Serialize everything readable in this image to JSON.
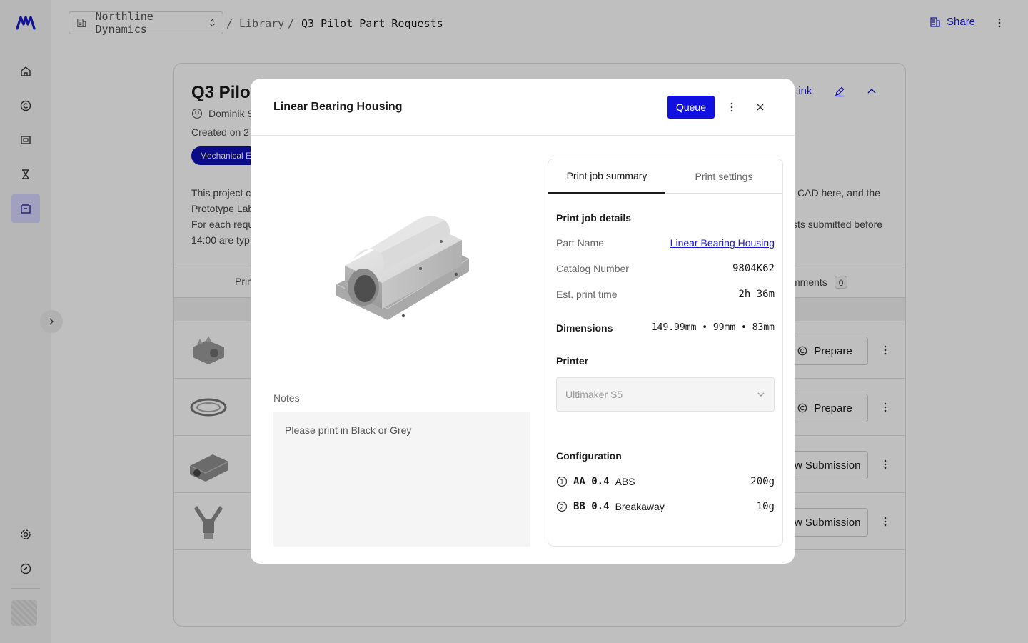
{
  "topbar": {
    "org": "Northline Dynamics",
    "breadcrumbs": [
      "Library",
      "Q3 Pilot Part Requests"
    ],
    "share_label": "Share"
  },
  "project": {
    "title": "Q3 Pilot Part Requests",
    "owner": "Dominik S",
    "created": "Created on 2",
    "tag": "Mechanical E",
    "description_left": [
      "This project c",
      "Prototype Lab",
      "For each requ",
      "14:00 are typ"
    ],
    "description_right": [
      "CAD here, and the",
      "",
      "sts submitted before",
      ""
    ],
    "link_label": "Link",
    "tabs": {
      "first": "Prin",
      "comments": "mments",
      "comments_count": "0"
    },
    "rows": [
      {
        "action": "Prepare"
      },
      {
        "action": "Prepare"
      },
      {
        "action": "ew Submission"
      },
      {
        "action": "ew Submission"
      }
    ]
  },
  "modal": {
    "title": "Linear Bearing Housing",
    "queue_label": "Queue",
    "notes_label": "Notes",
    "notes_value": "Please print in Black or Grey",
    "tabs": [
      "Print job summary",
      "Print settings"
    ],
    "details": {
      "section_title": "Print job details",
      "part_name_label": "Part Name",
      "part_name_value": "Linear Bearing Housing",
      "catalog_label": "Catalog Number",
      "catalog_value": "9804K62",
      "time_label": "Est. print time",
      "time_value": "2h 36m",
      "dimensions_label": "Dimensions",
      "dimensions_value": "149.99mm • 99mm • 83mm"
    },
    "printer": {
      "section_title": "Printer",
      "selected": "Ultimaker S5"
    },
    "configuration": {
      "section_title": "Configuration",
      "extruders": [
        {
          "index": "1",
          "nozzle": "AA 0.4",
          "material": "ABS",
          "weight": "200g"
        },
        {
          "index": "2",
          "nozzle": "BB 0.4",
          "material": "Breakaway",
          "weight": "10g"
        }
      ]
    }
  },
  "colors": {
    "accent": "#1010e0",
    "link": "#1b1bd6",
    "overlay": "rgba(0,0,0,0.25)"
  }
}
